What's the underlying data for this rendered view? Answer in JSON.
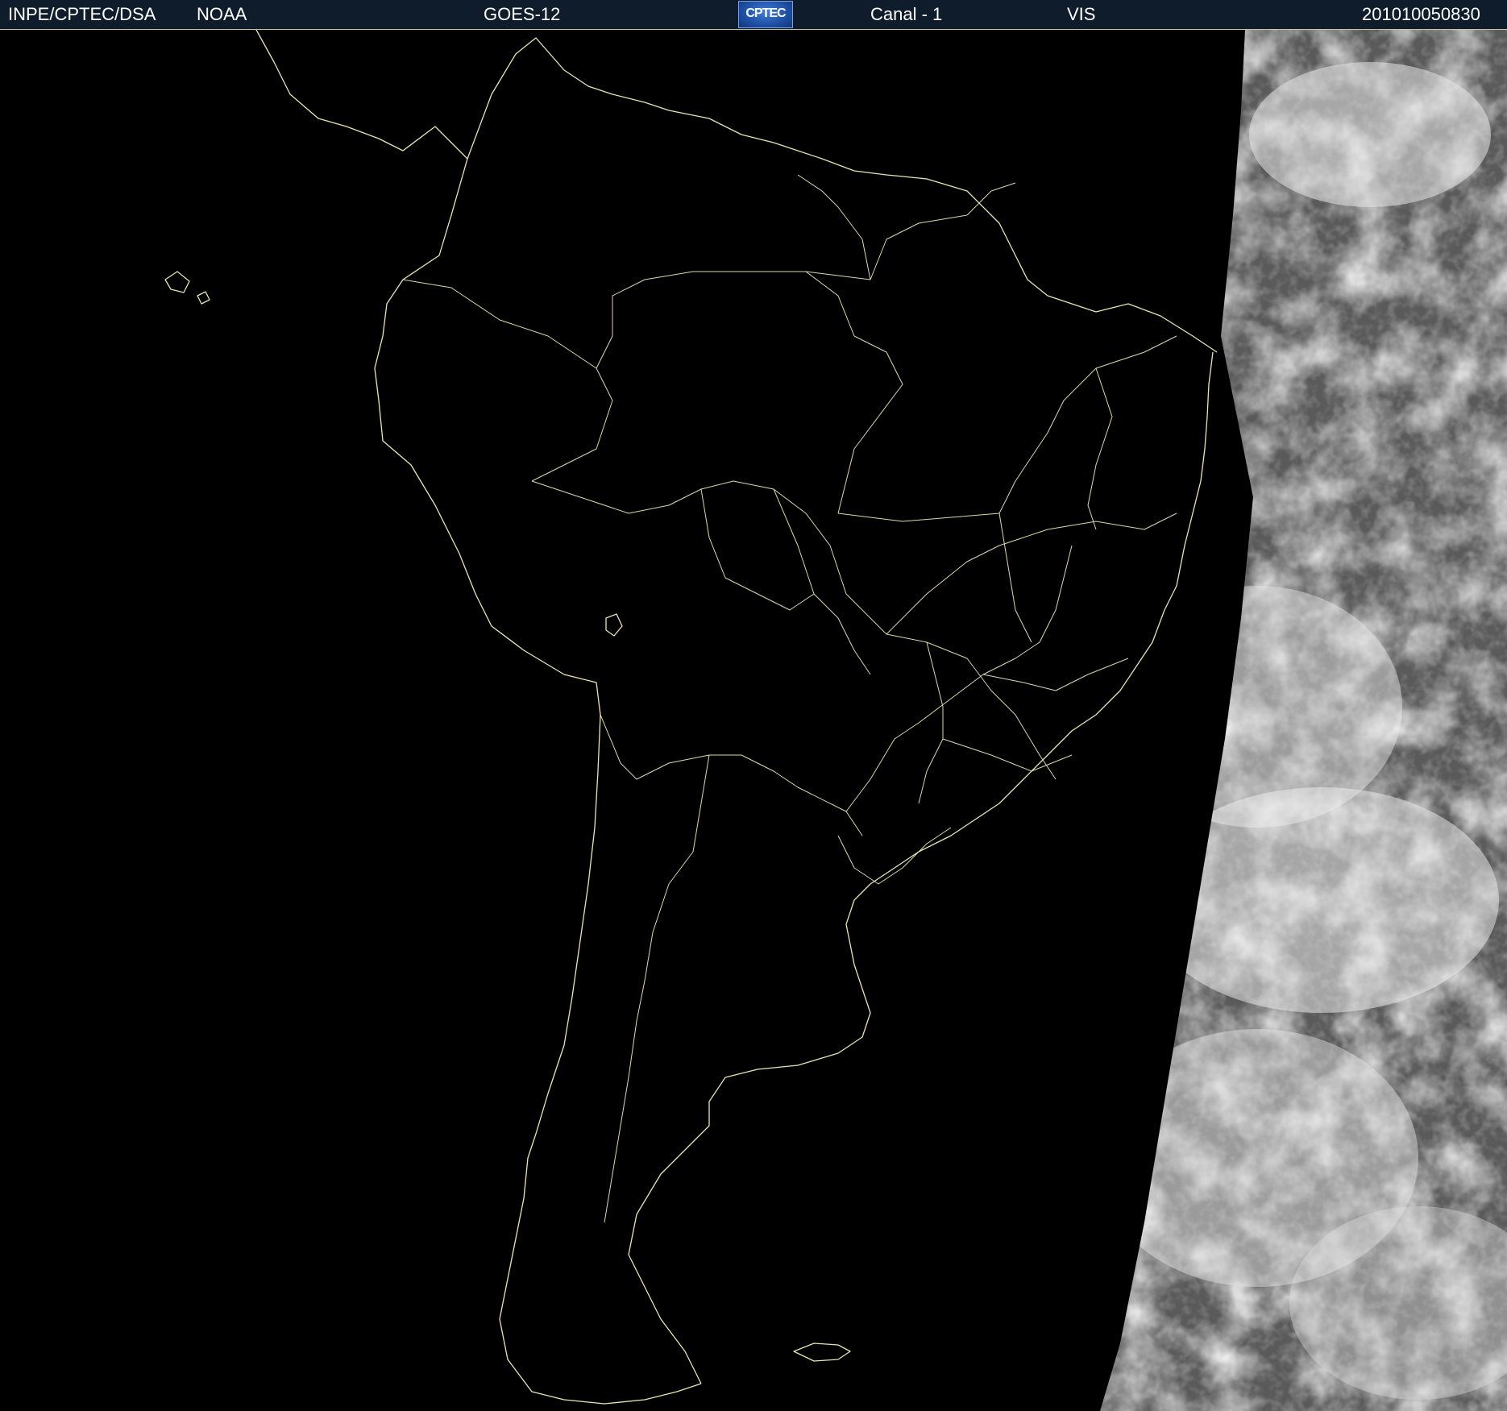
{
  "header": {
    "organization": "INPE/CPTEC/DSA",
    "agency": "NOAA",
    "satellite": "GOES-12",
    "logo_text": "CPTEC",
    "channel": "Canal - 1",
    "band": "VIS",
    "timestamp": "201010050830"
  },
  "image": {
    "background_color": "#000000",
    "coastline_color": "#e8e6b0",
    "cloud_color": "#d8d8d8",
    "header_color": "#0e1c2b"
  }
}
